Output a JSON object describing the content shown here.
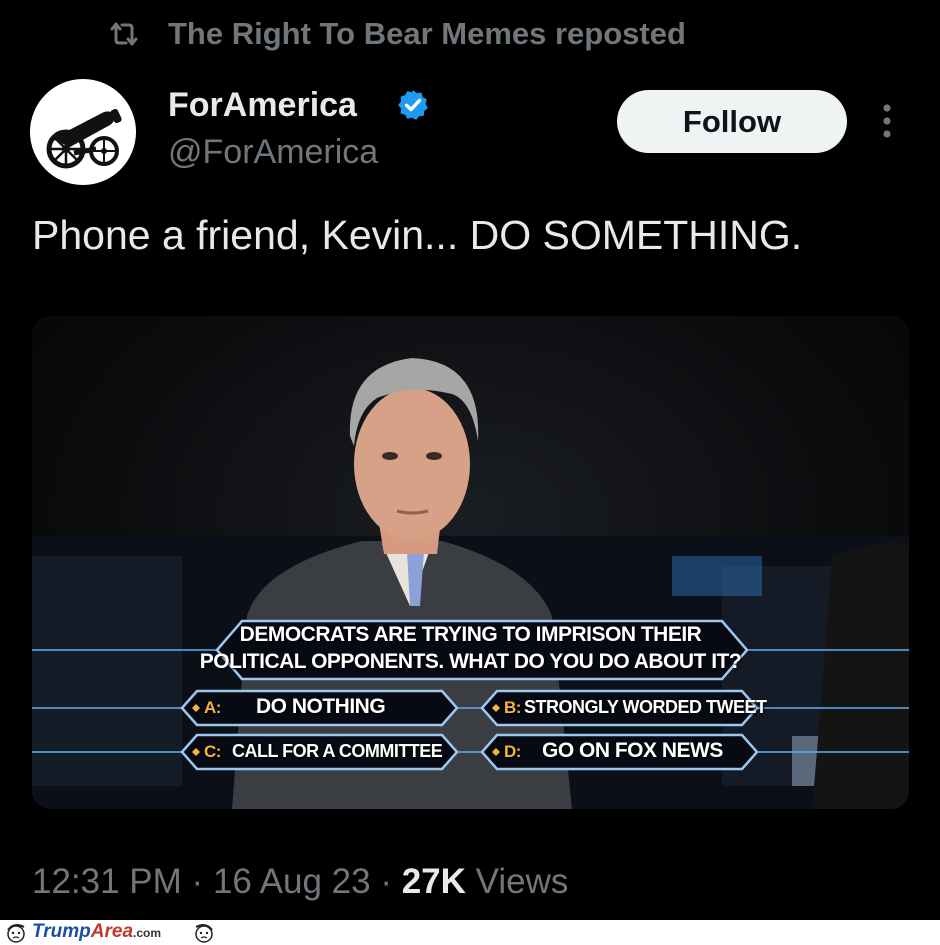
{
  "repost": {
    "text": "The Right To Bear Memes reposted",
    "icon": "repost-icon"
  },
  "author": {
    "display_name": "ForAmerica",
    "handle": "@ForAmerica",
    "verified_color": "#1d9bf0",
    "avatar_icon": "cannon-icon"
  },
  "actions": {
    "follow_label": "Follow",
    "more_icon": "more-vertical-icon"
  },
  "tweet": {
    "text": "Phone a friend, Kevin... DO SOMETHING."
  },
  "media": {
    "question_line1": "DEMOCRATS ARE TRYING TO IMPRISON THEIR",
    "question_line2": "POLITICAL OPPONENTS. WHAT DO YOU DO ABOUT IT?",
    "answers": [
      {
        "letter": "A:",
        "text": "DO NOTHING"
      },
      {
        "letter": "B:",
        "text": "STRONGLY WORDED TWEET"
      },
      {
        "letter": "C:",
        "text": "CALL FOR A COMMITTEE"
      },
      {
        "letter": "D:",
        "text": "GO ON FOX NEWS"
      }
    ]
  },
  "meta": {
    "time": "12:31 PM",
    "sep1": "·",
    "date": "16 Aug 23",
    "sep2": "·",
    "views_count": "27K",
    "views_label": "Views"
  },
  "watermark": {
    "brand_a": "Trump",
    "brand_b": "Area",
    "domain": ".com"
  },
  "colors": {
    "background": "#000000",
    "muted": "#71767b",
    "text": "#e7e9ea",
    "follow_bg": "#eff3f4"
  }
}
